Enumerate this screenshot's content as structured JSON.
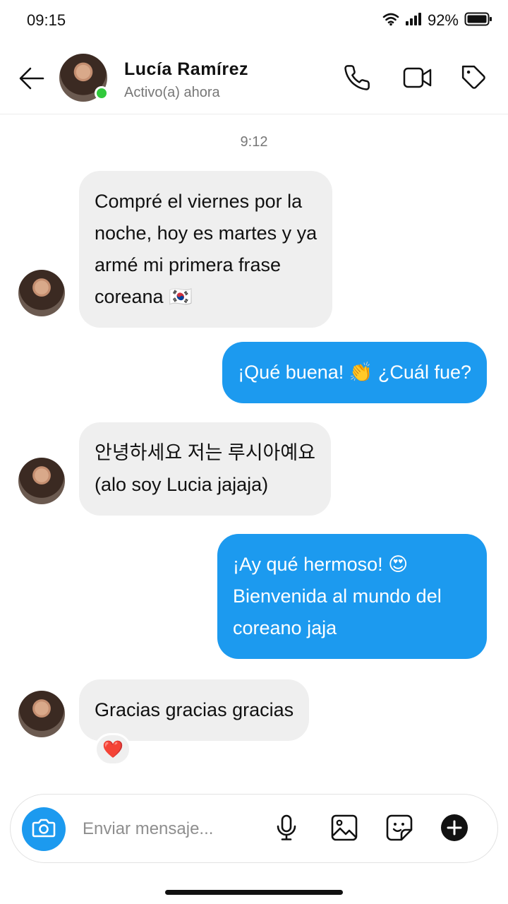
{
  "status_bar": {
    "time": "09:15",
    "battery": "92%"
  },
  "header": {
    "name": "Lucía  Ramírez",
    "status": "Activo(a) ahora"
  },
  "conversation": {
    "timestamp": "9:12",
    "messages": [
      {
        "direction": "in",
        "text": "Compré el viernes por la\nnoche, hoy es martes y ya\narmé mi primera frase\ncoreana 🇰🇷"
      },
      {
        "direction": "out",
        "text": "¡Qué buena! 👏 ¿Cuál fue?"
      },
      {
        "direction": "in",
        "text": "안녕하세요 저는 루시아예요\n(alo soy Lucia jajaja)"
      },
      {
        "direction": "out",
        "text": "¡Ay qué hermoso! 😍\nBienvenida al mundo del\ncoreano jaja"
      },
      {
        "direction": "in",
        "text": "Gracias gracias gracias"
      }
    ],
    "reaction": "❤️"
  },
  "composer": {
    "placeholder": "Enviar mensaje..."
  },
  "colors": {
    "accent": "#1c9aef",
    "incoming_bubble": "#efefef",
    "online": "#31c93c"
  },
  "icons": {
    "header": [
      "back-arrow-icon",
      "phone-icon",
      "video-camera-icon",
      "tag-icon"
    ],
    "composer": [
      "camera-icon",
      "microphone-icon",
      "image-icon",
      "sticker-icon",
      "plus-icon"
    ]
  }
}
